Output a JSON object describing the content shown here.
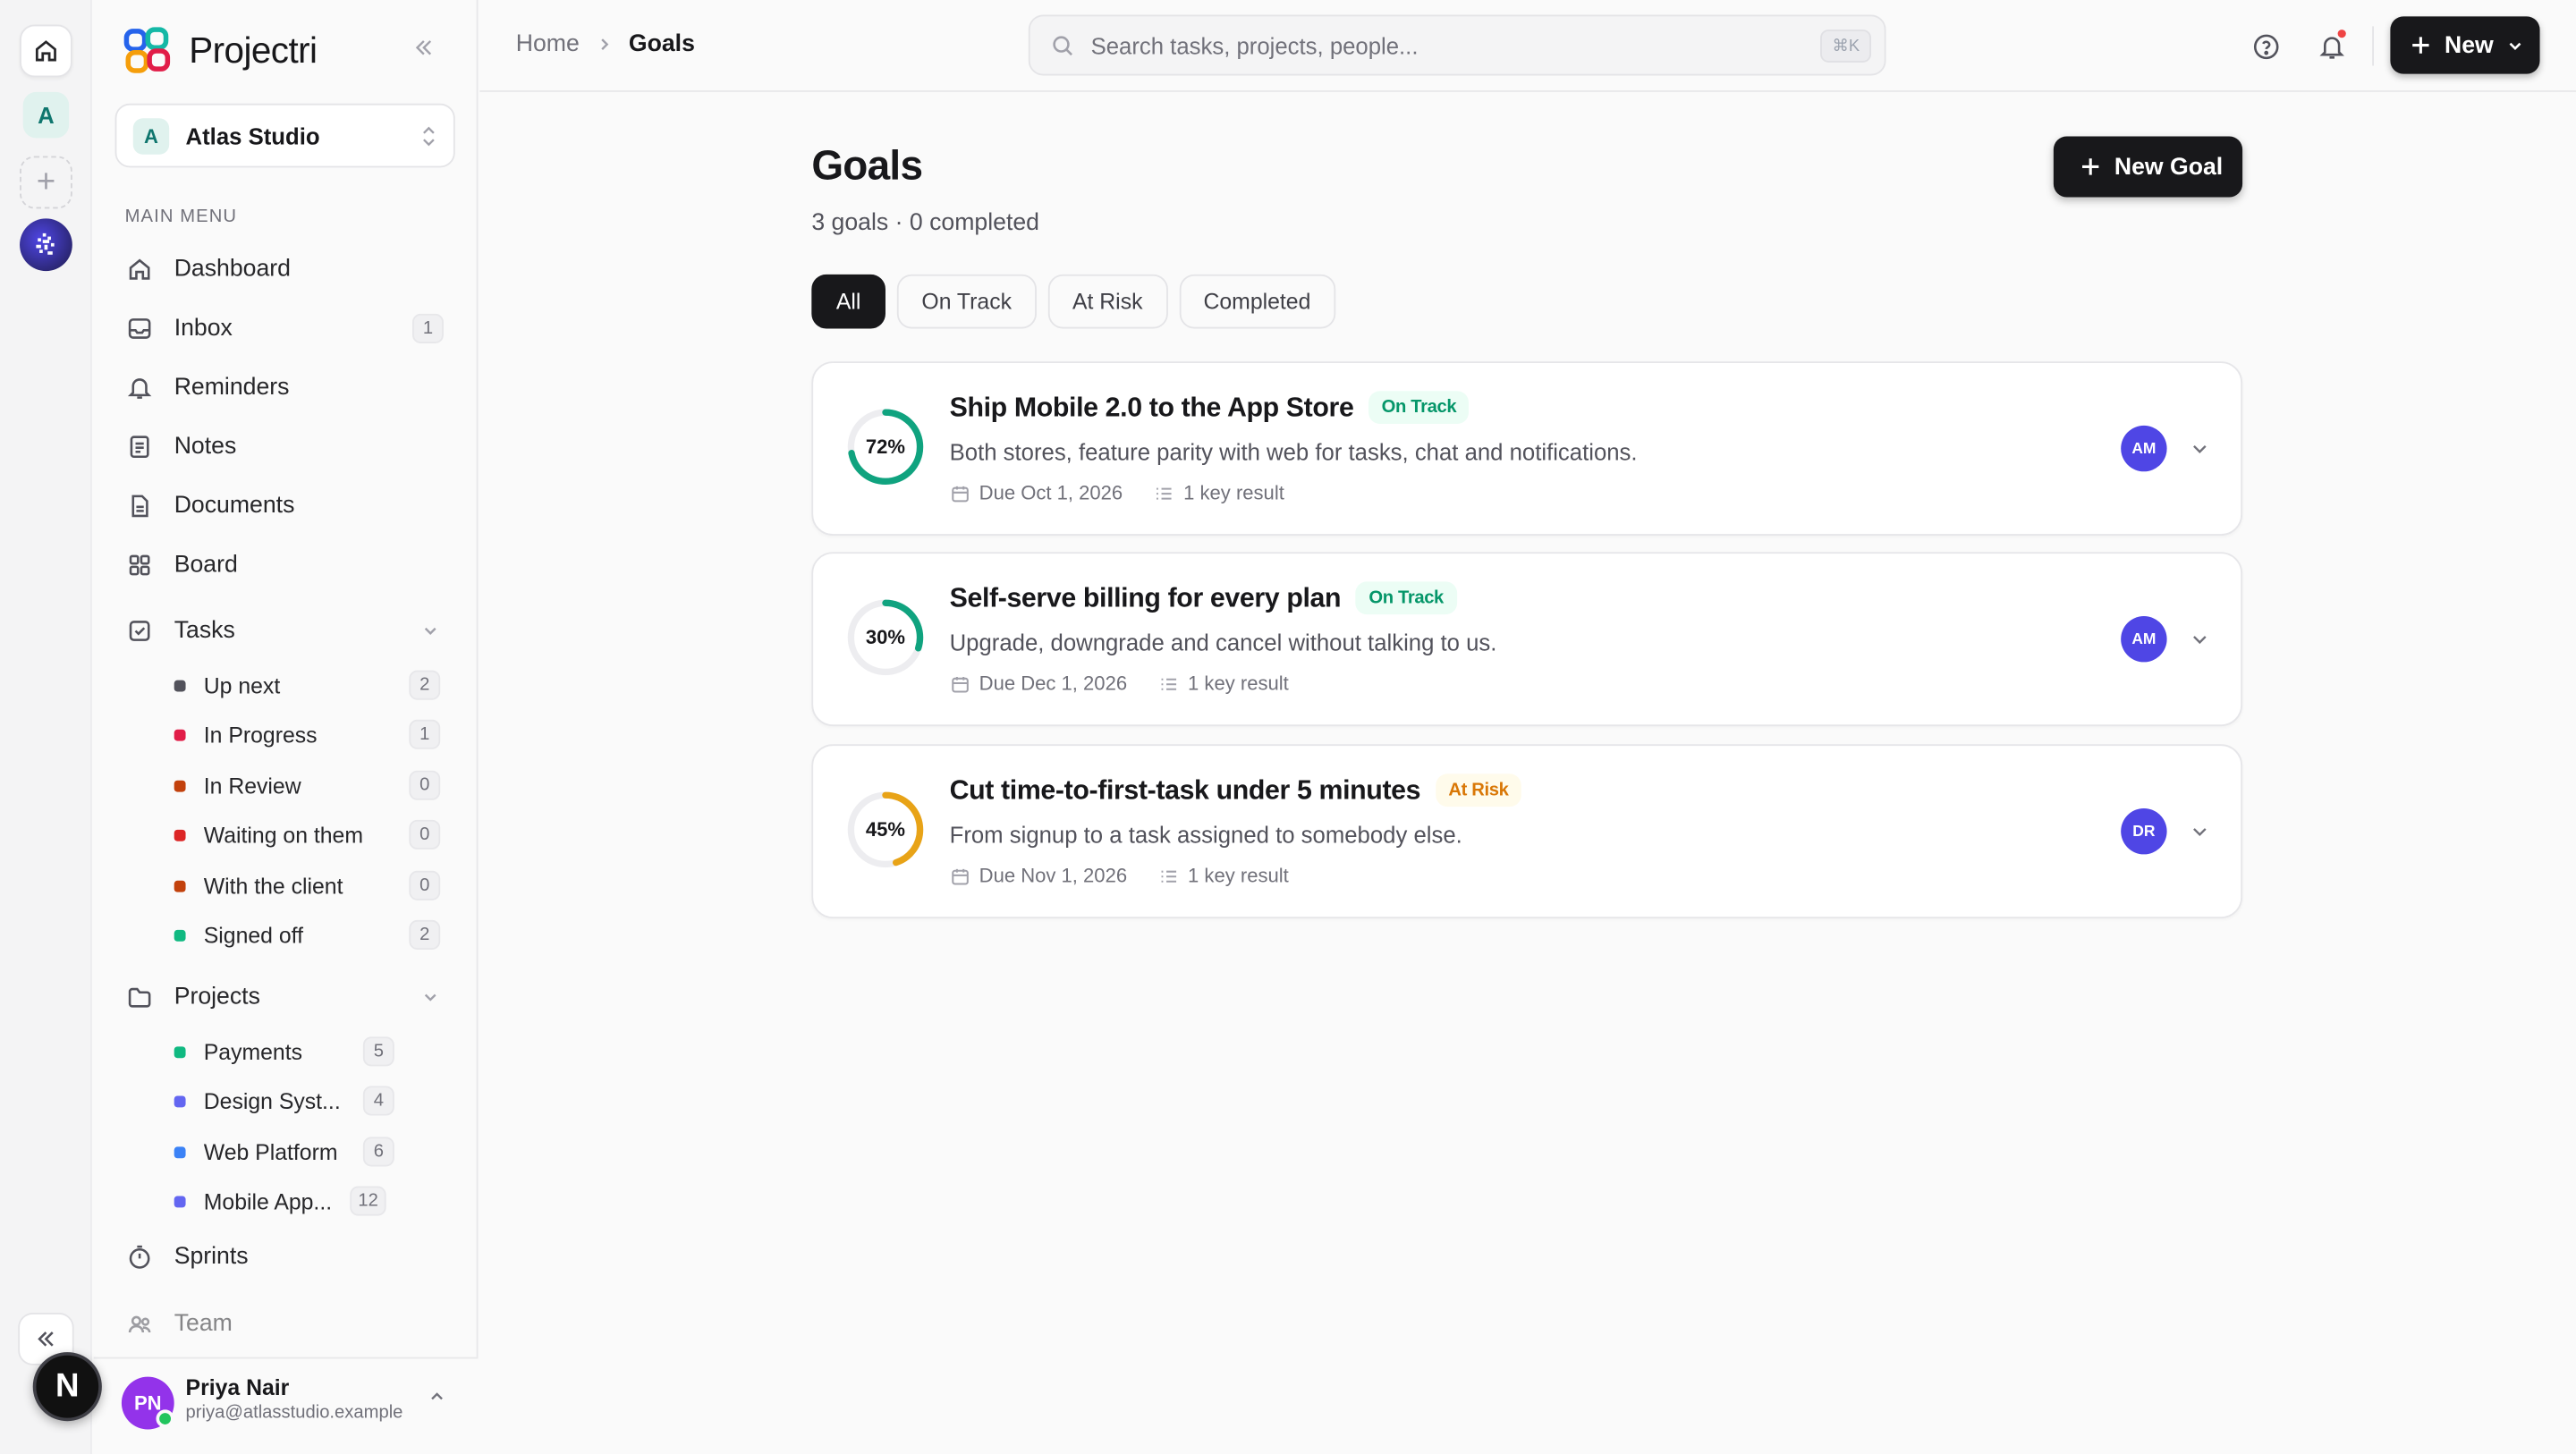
{
  "app": {
    "name": "Projectri"
  },
  "rail": {
    "workspace_initial": "A",
    "add_symbol": "+",
    "n_badge": "N"
  },
  "workspace": {
    "initial": "A",
    "name": "Atlas Studio"
  },
  "sidebar": {
    "section_label": "MAIN MENU",
    "items": [
      {
        "label": "Dashboard",
        "icon": "home-icon"
      },
      {
        "label": "Inbox",
        "icon": "inbox-icon",
        "badge": "1"
      },
      {
        "label": "Reminders",
        "icon": "bell-icon"
      },
      {
        "label": "Notes",
        "icon": "notes-icon"
      },
      {
        "label": "Documents",
        "icon": "document-icon"
      },
      {
        "label": "Board",
        "icon": "board-icon"
      },
      {
        "label": "Tasks",
        "icon": "checkbox-icon"
      },
      {
        "label": "Projects",
        "icon": "folder-icon"
      },
      {
        "label": "Sprints",
        "icon": "timer-icon"
      },
      {
        "label": "Team",
        "icon": "team-icon"
      }
    ],
    "tasks": [
      {
        "label": "Up next",
        "count": "2",
        "color": "#52525b"
      },
      {
        "label": "In Progress",
        "count": "1",
        "color": "#eab308"
      },
      {
        "label": "In Review",
        "count": "0",
        "color": "#e11d48"
      },
      {
        "label": "Waiting on them",
        "count": "0",
        "color": "#dc2626"
      },
      {
        "label": "With the client",
        "count": "0",
        "color": "#c2410c"
      },
      {
        "label": "Signed off",
        "count": "2",
        "color": "#10b981"
      }
    ],
    "projects": [
      {
        "label": "Payments",
        "count": "5",
        "color": "#10b981"
      },
      {
        "label": "Design Syst...",
        "count": "4",
        "color": "#e11d48"
      },
      {
        "label": "Web Platform",
        "count": "6",
        "color": "#3b82f6"
      },
      {
        "label": "Mobile App...",
        "count": "12",
        "color": "#6366f1"
      }
    ]
  },
  "user": {
    "initials": "PN",
    "name": "Priya Nair",
    "email": "priya@atlasstudio.example"
  },
  "topbar": {
    "breadcrumb_home": "Home",
    "breadcrumb_current": "Goals",
    "search_placeholder": "Search tasks, projects, people...",
    "search_shortcut": "⌘K",
    "new_label": "New"
  },
  "page": {
    "title": "Goals",
    "subtitle": "3 goals · 0 completed",
    "new_goal_label": "New Goal",
    "tabs": [
      "All",
      "On Track",
      "At Risk",
      "Completed"
    ],
    "active_tab": "All"
  },
  "goals": [
    {
      "progress": 0.72,
      "progress_label": "72%",
      "title": "Ship Mobile 2.0 to the App Store",
      "status": "On Track",
      "description": "Both stores, feature parity with web for tasks, chat and notifications.",
      "due": "Due Oct 1, 2026",
      "key_results": "1 key result",
      "assignee": "AM",
      "color": "#10a37f"
    },
    {
      "progress": 0.3,
      "progress_label": "30%",
      "title": "Self-serve billing for every plan",
      "status": "On Track",
      "description": "Upgrade, downgrade and cancel without talking to us.",
      "due": "Due Dec 1, 2026",
      "key_results": "1 key result",
      "assignee": "AM",
      "color": "#10a37f"
    },
    {
      "progress": 0.45,
      "progress_label": "45%",
      "title": "Cut time-to-first-task under 5 minutes",
      "status": "At Risk",
      "description": "From signup to a task assigned to somebody else.",
      "due": "Due Nov 1, 2026",
      "key_results": "1 key result",
      "assignee": "DR",
      "color": "#e8a317"
    }
  ],
  "colors": {
    "accent": "#18181b",
    "on_track": "#059669",
    "at_risk": "#d97706",
    "assignee": "#4f46e5"
  }
}
